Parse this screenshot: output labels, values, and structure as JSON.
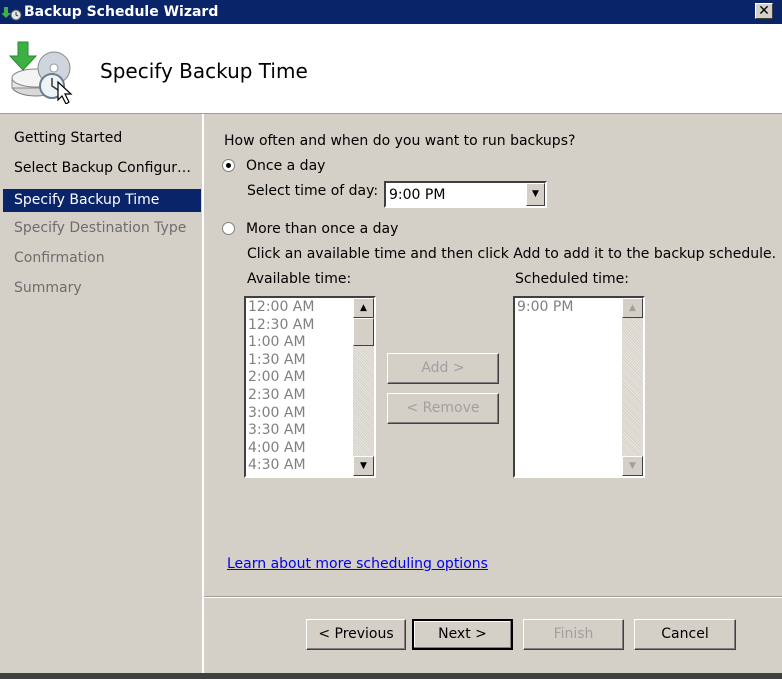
{
  "window": {
    "title": "Backup Schedule Wizard",
    "close_label": "✕"
  },
  "header": {
    "page_title": "Specify Backup Time"
  },
  "sidebar": {
    "items": [
      {
        "label": "Getting Started",
        "state": "done"
      },
      {
        "label": "Select Backup Configur…",
        "state": "done"
      },
      {
        "label": "Specify Backup Time",
        "state": "active"
      },
      {
        "label": "Specify Destination Type",
        "state": "future"
      },
      {
        "label": "Confirmation",
        "state": "future"
      },
      {
        "label": "Summary",
        "state": "future"
      }
    ]
  },
  "main": {
    "question": "How often and when do you want to run backups?",
    "once_a_day": {
      "label": "Once a day",
      "selected": true
    },
    "select_time_label": "Select time of day:",
    "select_time_value": "9:00 PM",
    "more_than_once": {
      "label": "More than once a day",
      "selected": false
    },
    "instructions": "Click an available time and then click Add to add it to the backup schedule.",
    "available_label": "Available time:",
    "available_times": [
      "12:00 AM",
      "12:30 AM",
      "1:00 AM",
      "1:30 AM",
      "2:00 AM",
      "2:30 AM",
      "3:00 AM",
      "3:30 AM",
      "4:00 AM",
      "4:30 AM"
    ],
    "scheduled_label": "Scheduled time:",
    "scheduled_times": [
      "9:00 PM"
    ],
    "add_label": "Add >",
    "remove_label": "< Remove",
    "learn_more_link": "Learn about more scheduling options"
  },
  "footer": {
    "previous_label": "< Previous",
    "next_label": "Next >",
    "finish_label": "Finish",
    "cancel_label": "Cancel"
  },
  "icons": {
    "scroll_up": "▲",
    "scroll_down": "▼",
    "dropdown": "▼"
  }
}
